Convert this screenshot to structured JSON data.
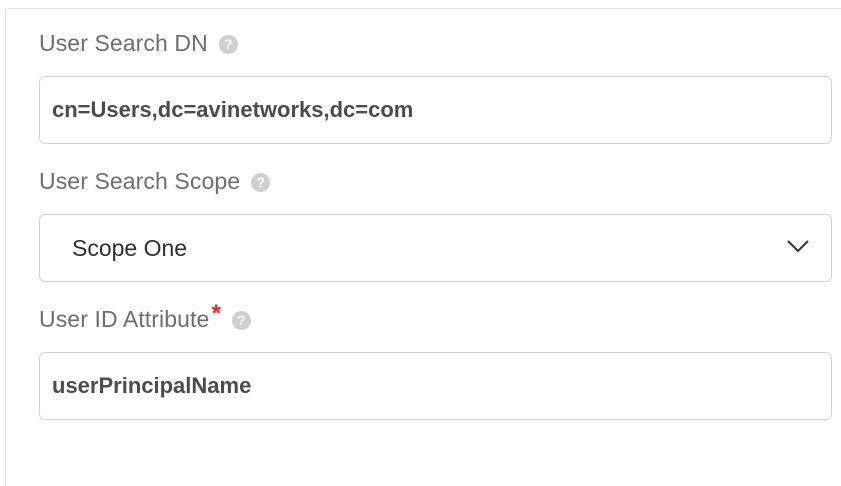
{
  "fields": [
    {
      "label": "User Search DN",
      "value": "cn=Users,dc=avinetworks,dc=com",
      "help_icon": "question-circle-icon"
    },
    {
      "label": "User Search Scope",
      "value": "Scope One",
      "help_icon": "question-circle-icon",
      "dropdown_icon": "chevron-down-icon"
    },
    {
      "label": "User ID Attribute",
      "required_marker": "*",
      "value": "userPrincipalName",
      "help_icon": "question-circle-icon"
    }
  ],
  "colors": {
    "label": "#6e6e6e",
    "required": "#e8221a",
    "border": "#d2d2d2",
    "help_icon": "#cfcfcf"
  }
}
